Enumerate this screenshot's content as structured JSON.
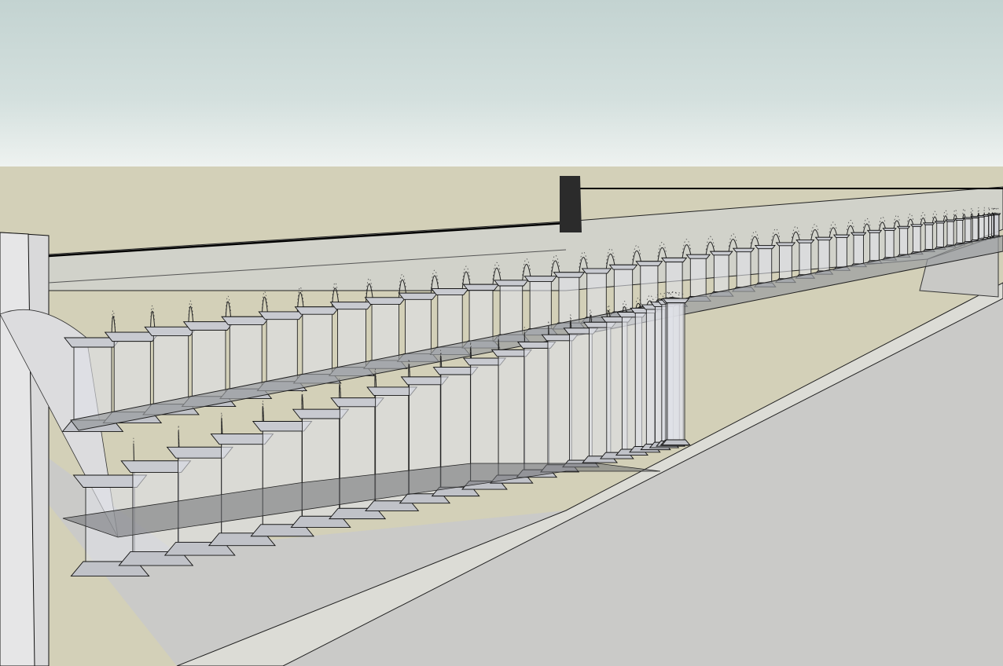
{
  "viewport": {
    "sky_top_color": "#c3d3d1",
    "sky_horizon_color": "#eef2f0",
    "ground_color": "#d3d0b8",
    "model": "aqueduct",
    "style": "x-ray wireframe",
    "upper_arcade_arch_count": 44,
    "lower_arcade_arch_count": 24
  }
}
